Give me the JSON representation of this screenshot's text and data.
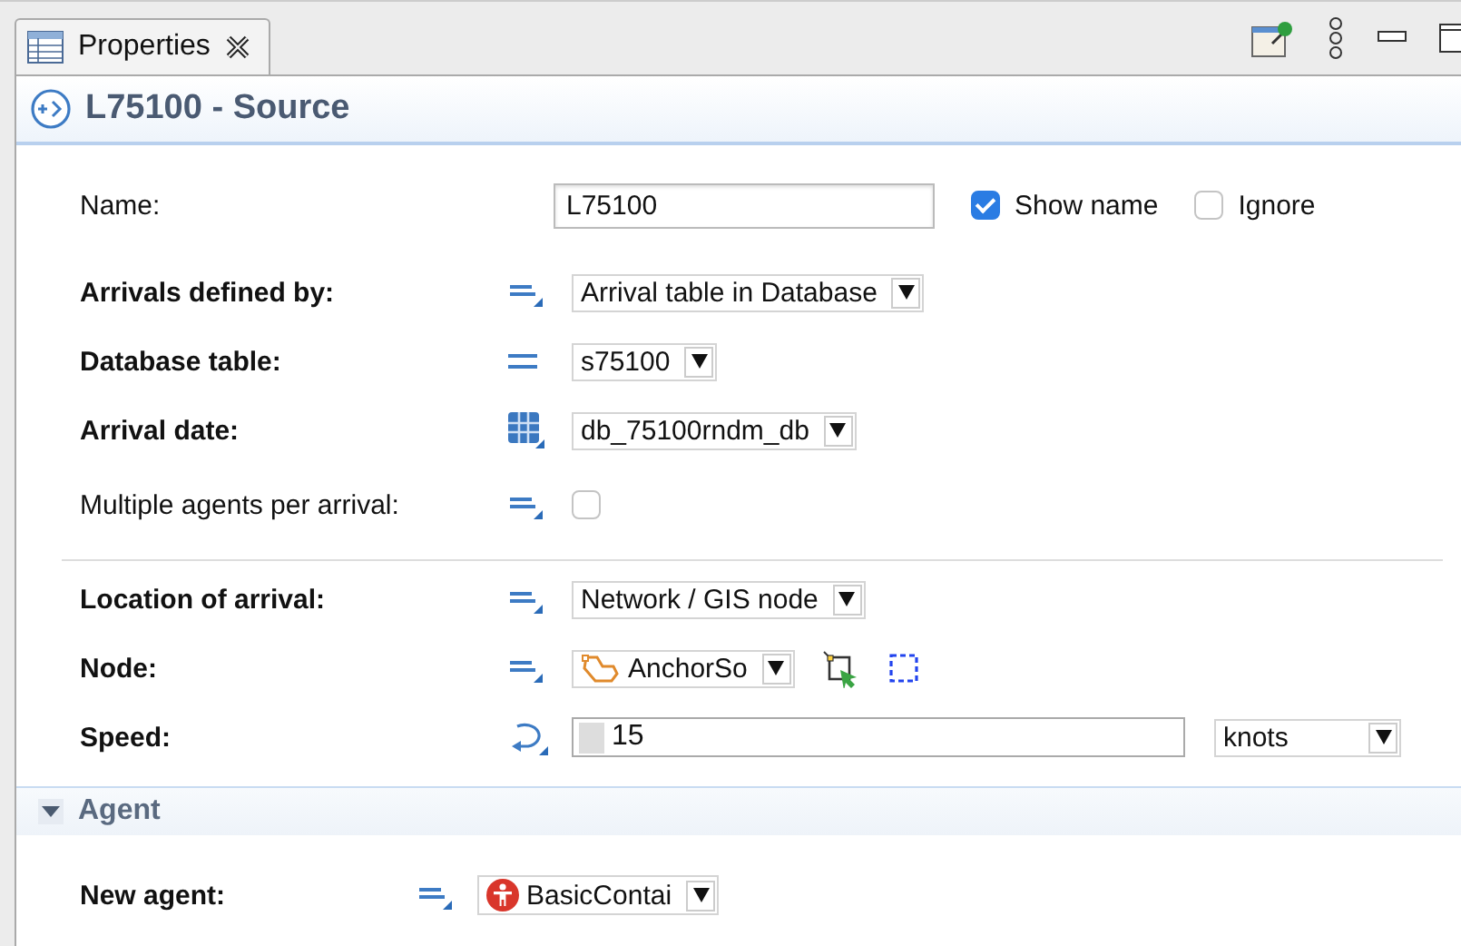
{
  "tab": {
    "label": "Properties",
    "selected": true
  },
  "header": {
    "title": "L75100 - Source"
  },
  "name_row": {
    "label": "Name:",
    "value": "L75100",
    "options": [
      {
        "label": "Show name",
        "checked": true
      },
      {
        "label": "Ignore",
        "checked": false
      }
    ]
  },
  "groups": [
    {
      "fields": [
        {
          "kind": "combo",
          "label": "Arrivals defined by:",
          "bold": true,
          "mode_icon": {
            "kind": "dynamic"
          },
          "value": "Arrival table in Database"
        },
        {
          "kind": "combo",
          "label": "Database table:",
          "bold": true,
          "mode_icon": {
            "kind": "static"
          },
          "value": "s75100"
        },
        {
          "kind": "combo",
          "label": "Arrival date:",
          "bold": true,
          "mode_icon": {
            "kind": "table"
          },
          "value": "db_75100rndm_db"
        },
        {
          "kind": "checkbox",
          "label": "Multiple agents per arrival:",
          "bold": false,
          "mode_icon": {
            "kind": "dynamic"
          },
          "checked": false
        }
      ]
    },
    {
      "fields": [
        {
          "kind": "combo",
          "label": "Location of arrival:",
          "bold": true,
          "mode_icon": {
            "kind": "dynamic"
          },
          "value": "Network / GIS node"
        },
        {
          "kind": "node",
          "label": "Node:",
          "bold": true,
          "mode_icon": {
            "kind": "dynamic"
          },
          "value": "AnchorSo"
        },
        {
          "kind": "number",
          "label": "Speed:",
          "bold": true,
          "mode_icon": {
            "kind": "loop"
          },
          "value": "15",
          "unit": "knots"
        }
      ]
    }
  ],
  "section": {
    "title": "Agent",
    "expanded": true,
    "fields": [
      {
        "kind": "agent",
        "label": "New agent:",
        "bold": true,
        "mode_icon": {
          "kind": "dynamic"
        },
        "value": "BasicContai"
      }
    ]
  }
}
